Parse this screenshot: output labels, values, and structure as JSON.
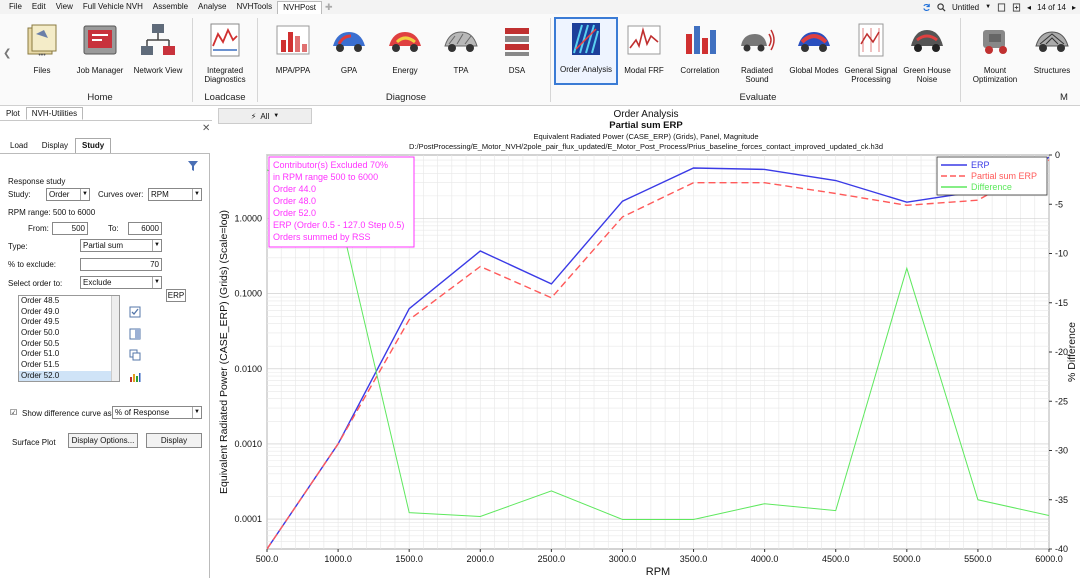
{
  "menubar": {
    "items": [
      "File",
      "Edit",
      "View",
      "Full Vehicle NVH",
      "Assemble",
      "Analyse",
      "NVHTools",
      "NVHPost"
    ],
    "active": "NVHPost",
    "session": "Untitled",
    "page": "14 of 14"
  },
  "ribbon": {
    "buttons": [
      {
        "label": "Files",
        "dots": "•••"
      },
      {
        "label": "Job Manager"
      },
      {
        "label": "Network View"
      },
      {
        "label": "Integrated\nDiagnostics"
      },
      {
        "label": "MPA/PPA"
      },
      {
        "label": "GPA"
      },
      {
        "label": "Energy"
      },
      {
        "label": "TPA"
      },
      {
        "label": "DSA"
      },
      {
        "label": "Order Analysis"
      },
      {
        "label": "Modal FRF"
      },
      {
        "label": "Correlation"
      },
      {
        "label": "Radiated\nSound"
      },
      {
        "label": "Global Modes"
      },
      {
        "label": "General Signal\nProcessing"
      },
      {
        "label": "Green House\nNoise"
      },
      {
        "label": "Mount\nOptimization"
      },
      {
        "label": "Structures"
      }
    ],
    "groups": [
      "Home",
      "Loadcase",
      "Diagnose",
      "Evaluate",
      "M"
    ]
  },
  "panel_tabs": [
    "Plot",
    "NVH-Utilities"
  ],
  "context_filter": "All",
  "left_tabs": [
    "Load",
    "Display",
    "Study"
  ],
  "study": {
    "section_title": "Response study",
    "study_label": "Study:",
    "study_value": "Order",
    "curves_over_label": "Curves over:",
    "curves_over_value": "RPM",
    "rpm_range_text": "RPM range: 500 to 6000",
    "from_label": "From:",
    "from_value": "500",
    "to_label": "To:",
    "to_value": "6000",
    "type_label": "Type:",
    "type_value": "Partial sum",
    "exclude_pct_label": "% to exclude:",
    "exclude_pct_value": "70",
    "select_order_label": "Select order to:",
    "select_order_value": "Exclude",
    "erp_button": "ERP",
    "orders": [
      "Order 48.5",
      "Order 49.0",
      "Order 49.5",
      "Order 50.0",
      "Order 50.5",
      "Order 51.0",
      "Order 51.5",
      "Order 52.0"
    ],
    "selected_order": "Order 52.0",
    "show_diff_label": "Show difference curve as:",
    "show_diff_value": "% of Response",
    "surface_plot_label": "Surface Plot",
    "display_options_button": "Display Options...",
    "display_button": "Display"
  },
  "chart_data": {
    "type": "line",
    "title": "Order Analysis",
    "subtitle": "Partial sum ERP",
    "subtitle2": "Equivalent Radiated Power (CASE_ERP) (Grids), Panel, Magnitude",
    "path": "D:/PostProcessing/E_Motor_NVH/2pole_pair_flux_updated/E_Motor_Post_Process/Prius_baseline_forces_contact_improved_updated_ck.h3d",
    "xlabel": "RPM",
    "ylabel": "Equivalent Radiated Power (CASE_ERP) (Grids) (Scale=log)",
    "y2label": "% Difference",
    "xlim": [
      500,
      6000
    ],
    "ylim": [
      4e-05,
      7
    ],
    "y_scale": "log",
    "y2lim": [
      -40,
      0
    ],
    "x_ticks": [
      500,
      1000,
      1500,
      2000,
      2500,
      3000,
      3500,
      4000,
      4500,
      5000,
      5500,
      6000
    ],
    "x_tick_labels": [
      "500.0",
      "1000.0",
      "1500.0",
      "2000.0",
      "2500.0",
      "3000.0",
      "3500.0",
      "4000.0",
      "4500.0",
      "5000.0",
      "5500.0",
      "6000.0"
    ],
    "y_ticks": [
      0.0001,
      0.001,
      0.01,
      0.1,
      1
    ],
    "y_tick_labels": [
      "0.0001",
      "0.0010",
      "0.0100",
      "0.1000",
      "1.0000"
    ],
    "y2_ticks": [
      0,
      -5,
      -10,
      -15,
      -20,
      -25,
      -30,
      -35,
      -40
    ],
    "grid": true,
    "legend_position": "top-right",
    "annotation": [
      "Contributor(s) Excluded 70%",
      "in RPM range 500 to 6000",
      "   Order 44.0",
      "   Order 48.0",
      "   Order 52.0",
      "ERP (Order 0.5 - 127.0 Step 0.5)",
      "Orders summed by RSS"
    ],
    "x": [
      500,
      1000,
      1500,
      2000,
      2500,
      3000,
      3500,
      4000,
      4500,
      5000,
      5500,
      6000
    ],
    "series": [
      {
        "name": "ERP",
        "color": "#3a3ae6",
        "dash": "solid",
        "axis": "left",
        "values": [
          4e-05,
          0.001,
          0.063,
          0.37,
          0.135,
          1.7,
          4.7,
          4.5,
          3.2,
          1.65,
          2.3,
          6.5
        ]
      },
      {
        "name": "Partial sum ERP",
        "color": "#ff5a5a",
        "dash": "dashed",
        "axis": "left",
        "values": [
          4e-05,
          0.001,
          0.045,
          0.23,
          0.088,
          1.05,
          3.0,
          3.0,
          2.15,
          1.5,
          1.75,
          6.0
        ]
      },
      {
        "name": "Difference",
        "color": "#5ee85e",
        "dash": "solid",
        "axis": "right",
        "values": [
          -1.5,
          -5.5,
          -36.3,
          -36.7,
          -34.1,
          -37.0,
          -37.0,
          -35.4,
          -36.1,
          -11.5,
          -35.0,
          -36.6
        ]
      }
    ]
  }
}
